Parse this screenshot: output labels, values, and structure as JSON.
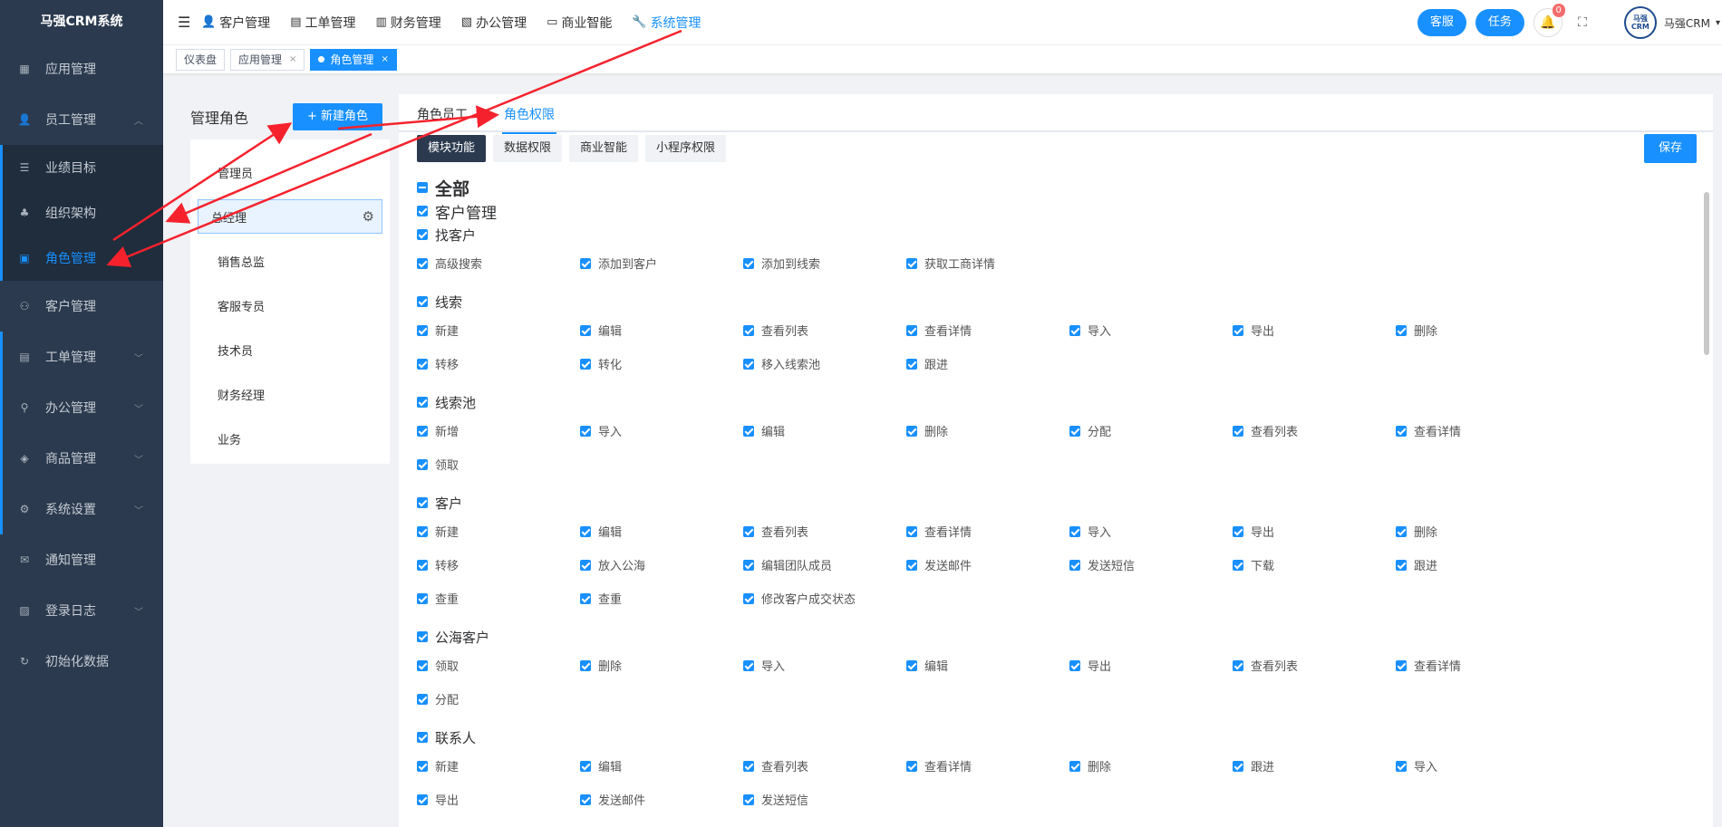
{
  "app": {
    "title": "马强CRM系统"
  },
  "sidebar": {
    "items": [
      {
        "label": "应用管理",
        "icon": "grid-icon"
      },
      {
        "label": "员工管理",
        "icon": "user-icon",
        "open": true,
        "children": [
          {
            "label": "业绩目标",
            "icon": "list-icon"
          },
          {
            "label": "组织架构",
            "icon": "org-icon"
          },
          {
            "label": "角色管理",
            "icon": "role-icon",
            "active": true
          }
        ]
      },
      {
        "label": "客户管理",
        "icon": "customers-icon"
      },
      {
        "label": "工单管理",
        "icon": "clipboard-icon"
      },
      {
        "label": "办公管理",
        "icon": "stamp-icon"
      },
      {
        "label": "商品管理",
        "icon": "cube-icon"
      },
      {
        "label": "系统设置",
        "icon": "settings-icon"
      },
      {
        "label": "通知管理",
        "icon": "notice-icon"
      },
      {
        "label": "登录日志",
        "icon": "log-icon"
      },
      {
        "label": "初始化数据",
        "icon": "refresh-icon"
      }
    ]
  },
  "topnav": {
    "items": [
      {
        "label": "客户管理",
        "icon": "user-icon"
      },
      {
        "label": "工单管理",
        "icon": "clipboard-icon"
      },
      {
        "label": "财务管理",
        "icon": "finance-icon"
      },
      {
        "label": "办公管理",
        "icon": "office-icon"
      },
      {
        "label": "商业智能",
        "icon": "chart-icon"
      },
      {
        "label": "系统管理",
        "icon": "wrench-icon",
        "active": true
      }
    ],
    "service_label": "客服",
    "task_label": "任务",
    "notification_count": "0",
    "avatar_text": "马强 CRM",
    "username": "马强CRM"
  },
  "tabs": [
    {
      "label": "仪表盘"
    },
    {
      "label": "应用管理"
    },
    {
      "label": "角色管理",
      "active": true
    }
  ],
  "roles_panel": {
    "title": "管理角色",
    "new_button": "+ 新建角色",
    "roles": [
      "管理员",
      "总经理",
      "销售总监",
      "客服专员",
      "技术员",
      "财务经理",
      "业务"
    ],
    "selected": "总经理"
  },
  "content": {
    "tabs": [
      "角色员工",
      "角色权限"
    ],
    "active_tab": "角色权限",
    "subtabs": [
      "模块功能",
      "数据权限",
      "商业智能",
      "小程序权限"
    ],
    "active_subtab": "模块功能",
    "save_label": "保存",
    "all_label": "全部",
    "module_label": "客户管理",
    "groups": [
      {
        "title": "找客户",
        "items": [
          "高级搜索",
          "添加到客户",
          "添加到线索",
          "获取工商详情"
        ]
      },
      {
        "title": "线索",
        "items": [
          "新建",
          "编辑",
          "查看列表",
          "查看详情",
          "导入",
          "导出",
          "删除",
          "转移",
          "转化",
          "移入线索池",
          "跟进"
        ]
      },
      {
        "title": "线索池",
        "items": [
          "新增",
          "导入",
          "编辑",
          "删除",
          "分配",
          "查看列表",
          "查看详情",
          "领取"
        ]
      },
      {
        "title": "客户",
        "items": [
          "新建",
          "编辑",
          "查看列表",
          "查看详情",
          "导入",
          "导出",
          "删除",
          "转移",
          "放入公海",
          "编辑团队成员",
          "发送邮件",
          "发送短信",
          "下载",
          "跟进",
          "查重",
          "查重",
          "修改客户成交状态"
        ]
      },
      {
        "title": "公海客户",
        "items": [
          "领取",
          "删除",
          "导入",
          "编辑",
          "导出",
          "查看列表",
          "查看详情",
          "分配"
        ]
      },
      {
        "title": "联系人",
        "items": [
          "新建",
          "编辑",
          "查看列表",
          "查看详情",
          "删除",
          "跟进",
          "导入",
          "导出",
          "发送邮件",
          "发送短信"
        ]
      }
    ]
  },
  "colors": {
    "primary": "#1890ff",
    "sidebar_bg": "#2b3a4e",
    "annotation": "#f5222d"
  }
}
